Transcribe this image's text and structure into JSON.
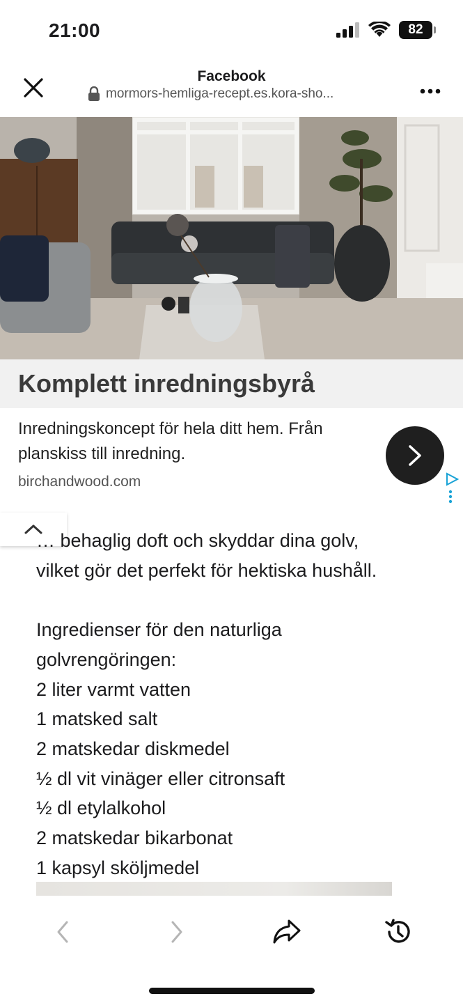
{
  "status_bar": {
    "time": "21:00",
    "battery": "82"
  },
  "browser": {
    "title": "Facebook",
    "url": "mormors-hemliga-recept.es.kora-sho..."
  },
  "ad": {
    "headline": "Komplett inredningsbyrå",
    "description": "Inredningskoncept för hela ditt hem. Från planskiss till inredning.",
    "domain": "birchandwood.com"
  },
  "article": {
    "intro_line1": "… behaglig doft och skyddar dina golv,",
    "intro_line2": "vilket gör det perfekt för hektiska hushåll.",
    "ingredients_heading_1": "Ingredienser för den naturliga",
    "ingredients_heading_2": "golvrengöringen:",
    "ingredients": [
      "2 liter varmt vatten",
      "1 matsked salt",
      "2 matskedar diskmedel",
      "½ dl vit vinäger eller citronsaft",
      "½ dl etylalkohol",
      "2 matskedar bikarbonat",
      "1 kapsyl sköljmedel"
    ]
  },
  "colors": {
    "ad_headline_bg": "#f1f1f1",
    "cta_bg": "#1f1f1f",
    "adchoices": "#1aa3d6"
  }
}
